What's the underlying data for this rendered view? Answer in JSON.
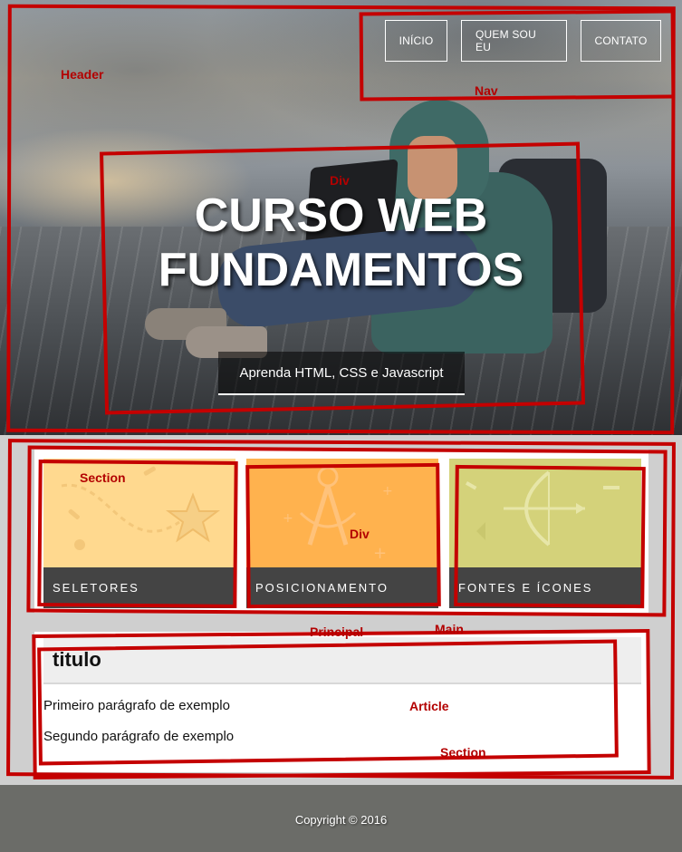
{
  "nav": {
    "items": [
      {
        "label": "INÍCIO"
      },
      {
        "label": "QUEM SOU EU"
      },
      {
        "label": "CONTATO"
      }
    ]
  },
  "hero": {
    "title_line1": "CURSO WEB",
    "title_line2": "FUNDAMENTOS",
    "subtitle": "Aprenda HTML, CSS e Javascript"
  },
  "cards": [
    {
      "label": "SELETORES"
    },
    {
      "label": "POSICIONAMENTO"
    },
    {
      "label": "FONTES E ÍCONES"
    }
  ],
  "article": {
    "title": "titulo",
    "paragraphs": [
      "Primeiro parágrafo de exemplo",
      "Segundo parágrafo de exemplo"
    ]
  },
  "footer": {
    "copyright": "Copyright © 2016"
  },
  "annotations": {
    "header": "Header",
    "nav": "Nav",
    "div_hero": "Div",
    "section_cards": "Section",
    "div_cards": "Div",
    "principal": "Principal",
    "main": "Main",
    "article": "Article",
    "section_article": "Section",
    "color": "#c40000"
  },
  "colors": {
    "card1": "#ffd98f",
    "card2": "#ffb24e",
    "card3": "#d4d27a",
    "card_label_bg": "#444444",
    "footer_bg": "#6b6c68"
  }
}
